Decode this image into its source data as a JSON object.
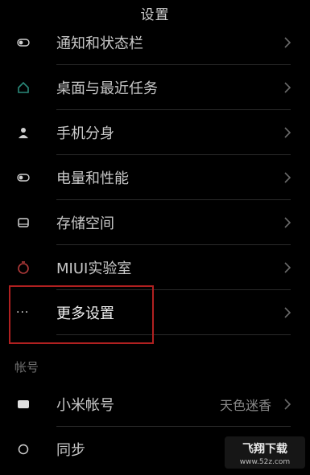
{
  "header": {
    "title": "设置"
  },
  "rows": [
    {
      "label": "通知和状态栏",
      "icon": "toggle-icon"
    },
    {
      "label": "桌面与最近任务",
      "icon": "home-icon"
    },
    {
      "label": "手机分身",
      "icon": "person-icon"
    },
    {
      "label": "电量和性能",
      "icon": "battery-icon"
    },
    {
      "label": "存储空间",
      "icon": "storage-icon"
    },
    {
      "label": "MIUI实验室",
      "icon": "flask-icon"
    },
    {
      "label": "更多设置",
      "icon": "more-dots-icon",
      "dots": "···"
    }
  ],
  "account_section": {
    "header": "帐号",
    "items": [
      {
        "label": "小米帐号",
        "value": "天色迷香",
        "icon": "mi-account-icon"
      },
      {
        "label": "同步",
        "icon": "sync-icon"
      }
    ]
  },
  "watermark": {
    "text_main": "飞翔下载",
    "text_url": "www.52z.com"
  },
  "colors": {
    "highlight": "#b02020",
    "background": "#000000",
    "accent_icon": "#2a8a7a"
  }
}
